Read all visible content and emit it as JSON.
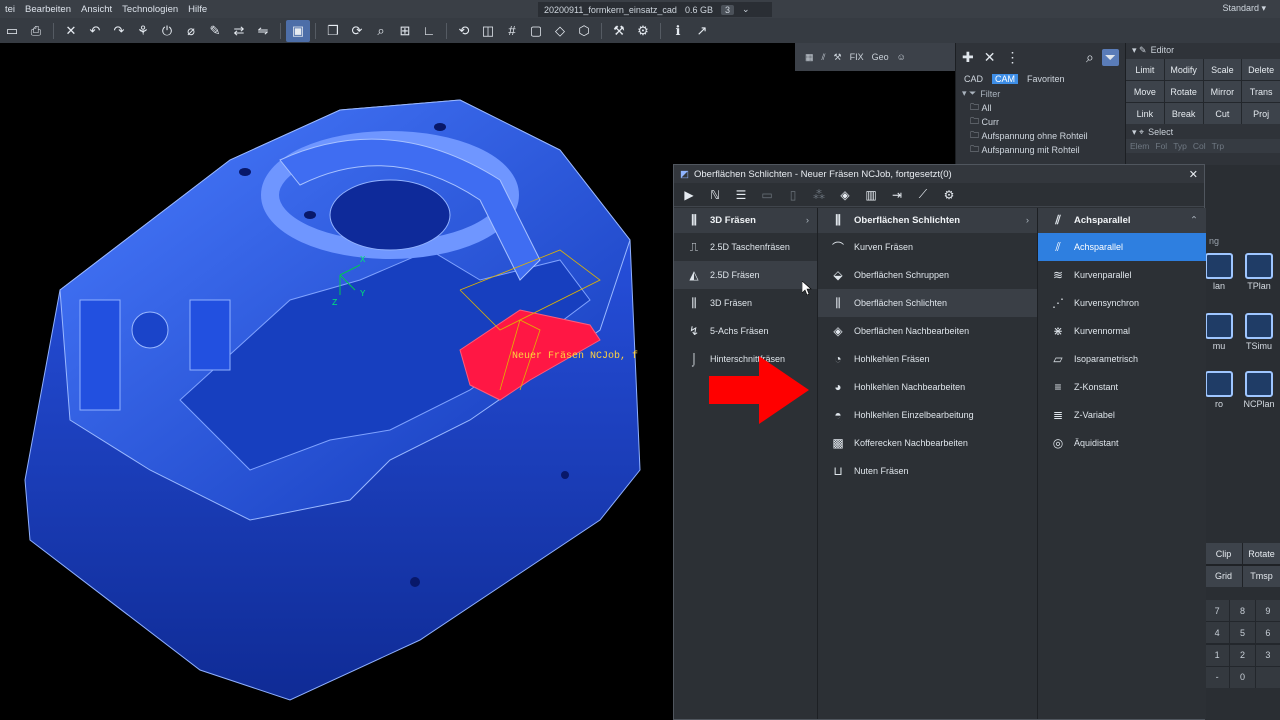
{
  "menubar": {
    "items": [
      "tei",
      "Bearbeiten",
      "Ansicht",
      "Technologien",
      "Hilfe"
    ],
    "doc_tab_name": "20200911_formkern_einsatz_cad",
    "doc_size": "0.6 GB",
    "doc_badge": "3",
    "mode": "Standard"
  },
  "quick_panel": {
    "fix_label": "FIX",
    "geo_label": "Geo"
  },
  "cam_panel": {
    "tabs": [
      "CAD",
      "CAM",
      "Favoriten"
    ],
    "active_tab": "CAM",
    "filter_label": "Filter",
    "filter_items": [
      "All",
      "Curr",
      "Aufspannung ohne Rohteil",
      "Aufspannung mit Rohteil"
    ]
  },
  "editor": {
    "title": "Editor",
    "buttons": [
      "Limit",
      "Modify",
      "Scale",
      "Delete",
      "Move",
      "Rotate",
      "Mirror",
      "Trans",
      "Link",
      "Break",
      "Cut",
      "Proj"
    ],
    "select_label": "Select",
    "select_cols": [
      "Elem",
      "Fol",
      "Typ",
      "Col",
      "Trp"
    ]
  },
  "right_lower": {
    "ng_label": "ng",
    "btn1": "lan",
    "btn2": "TPlan",
    "btn3": "mu",
    "btn4": "TSimu",
    "btn5": "ro",
    "btn6": "NCPlan",
    "clip": [
      "Clip",
      "Rotate",
      "Grid",
      "Tmsp"
    ],
    "numpad": [
      "7",
      "8",
      "9",
      "4",
      "5",
      "6",
      "1",
      "2",
      "3",
      "-",
      "0",
      ""
    ]
  },
  "viewport": {
    "nc_label": "Neuer Fräsen NCJob, f",
    "axes": [
      "X",
      "Y",
      "Z"
    ]
  },
  "dialog": {
    "title": "Oberflächen Schlichten - Neuer Fräsen NCJob, fortgesetzt(0)",
    "col1": {
      "header": "3D Fräsen",
      "items": [
        "2.5D Taschenfräsen",
        "2.5D Fräsen",
        "3D Fräsen",
        "5-Achs Fräsen",
        "Hinterschnittfräsen"
      ]
    },
    "col2": {
      "header": "Oberflächen Schlichten",
      "items": [
        "Kurven Fräsen",
        "Oberflächen Schruppen",
        "Oberflächen Schlichten",
        "Oberflächen Nachbearbeiten",
        "Hohlkehlen Fräsen",
        "Hohlkehlen Nachbearbeiten",
        "Hohlkehlen Einzelbearbeitung",
        "Kofferecken Nachbearbeiten",
        "Nuten Fräsen"
      ]
    },
    "col3": {
      "header": "Achsparallel",
      "items": [
        "Achsparallel",
        "Kurvenparallel",
        "Kurvensynchron",
        "Kurvennormal",
        "Isoparametrisch",
        "Z-Konstant",
        "Z-Variabel",
        "Äquidistant"
      ]
    }
  },
  "colors": {
    "accent": "#2e7fe0",
    "part_blue": "#1f4fd8",
    "highlight_red": "#ff1744",
    "arrow_red": "#ff0000"
  }
}
